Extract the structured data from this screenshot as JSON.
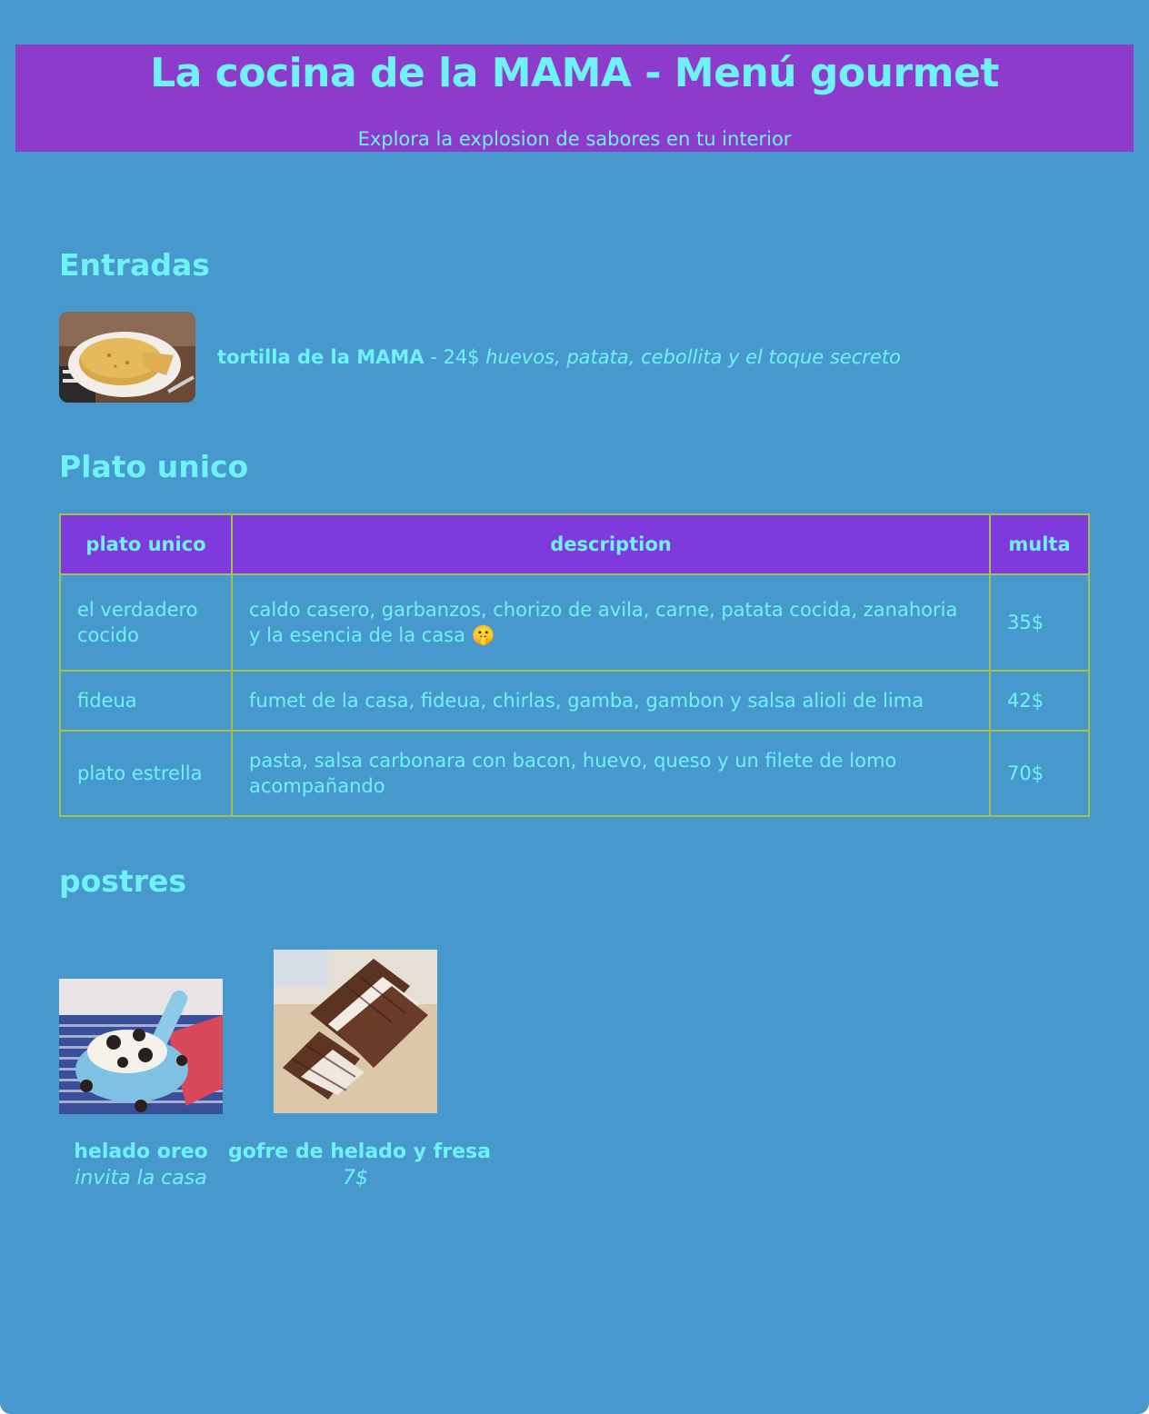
{
  "header": {
    "title": "La cocina de la MAMA - Menú gourmet",
    "subtitle": "Explora la explosion de sabores en tu interior"
  },
  "entradas": {
    "heading": "Entradas",
    "items": [
      {
        "name": "tortilla de la MAMA",
        "separator": " - ",
        "price": "24$",
        "description": "huevos, patata, cebollita y el toque secreto"
      }
    ]
  },
  "plato_unico": {
    "heading": "Plato unico",
    "columns": [
      "plato unico",
      "description",
      "multa"
    ],
    "rows": [
      {
        "name": "el verdadero cocido",
        "description": "caldo casero, garbanzos, chorizo de avila, carne, patata cocida, zanahoria y la esencia de la casa 🤫",
        "price": "35$"
      },
      {
        "name": "fideua",
        "description": "fumet de la casa, fideua, chirlas, gamba, gambon y salsa alioli de lima",
        "price": "42$"
      },
      {
        "name": "plato estrella",
        "description": "pasta, salsa carbonara con bacon, huevo, queso y un filete de lomo acompañando",
        "price": "70$"
      }
    ]
  },
  "postres": {
    "heading": "postres",
    "items": [
      {
        "name": "helado oreo",
        "price": "invita la casa"
      },
      {
        "name": "gofre de helado y fresa",
        "price": "7$"
      }
    ]
  }
}
